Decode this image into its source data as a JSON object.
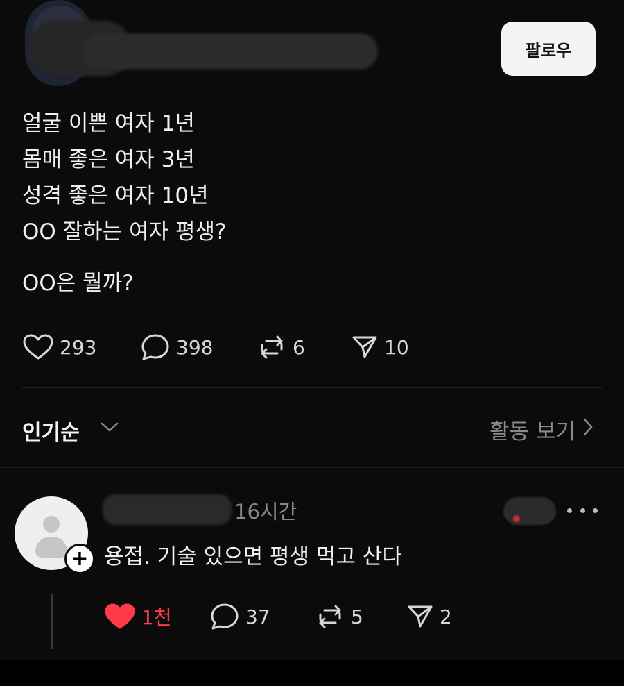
{
  "header": {
    "follow_label": "팔로우"
  },
  "post": {
    "lines": [
      "얼굴 이쁜 여자 1년",
      "몸매 좋은 여자 3년",
      "성격 좋은 여자 10년",
      "OO 잘하는 여자 평생?"
    ],
    "question": "OO은 뭘까?",
    "stats": {
      "likes": "293",
      "comments": "398",
      "reposts": "6",
      "shares": "10"
    }
  },
  "sort": {
    "label": "인기순",
    "activity_label": "활동 보기"
  },
  "comment": {
    "time": "16시간",
    "text": "용접. 기술 있으면 평생 먹고 산다",
    "stats": {
      "likes": "1천",
      "comments": "37",
      "reposts": "5",
      "shares": "2"
    }
  },
  "colors": {
    "background": "#0b0b0b",
    "like_active": "#ff3b4a",
    "muted_text": "#8a8a8a",
    "follow_button": "#f4f4f4"
  },
  "icons": [
    "heart-icon",
    "comment-icon",
    "repost-icon",
    "send-icon",
    "chevron-down-icon",
    "chevron-right-icon",
    "more-icon",
    "plus-icon",
    "avatar-icon"
  ]
}
